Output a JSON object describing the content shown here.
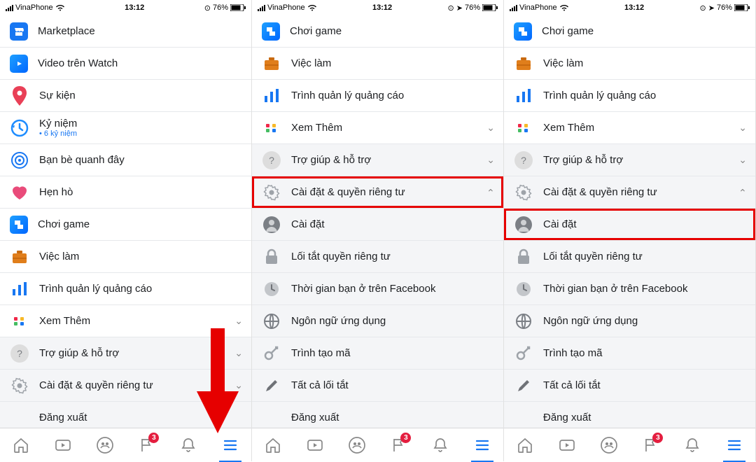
{
  "status": {
    "carrier": "VinaPhone",
    "time": "13:12",
    "battery": "76%"
  },
  "panel1": {
    "items": [
      {
        "icon": "marketplace",
        "label": "Marketplace"
      },
      {
        "icon": "video",
        "label": "Video trên Watch"
      },
      {
        "icon": "event",
        "label": "Sự kiện"
      },
      {
        "icon": "memory",
        "label": "Kỷ niệm",
        "sub": "6 kỷ niệm"
      },
      {
        "icon": "nearby",
        "label": "Bạn bè quanh đây"
      },
      {
        "icon": "dating",
        "label": "Hẹn hò"
      },
      {
        "icon": "game",
        "label": "Chơi game"
      },
      {
        "icon": "jobs",
        "label": "Việc làm"
      },
      {
        "icon": "ads",
        "label": "Trình quản lý quảng cáo"
      },
      {
        "icon": "more",
        "label": "Xem Thêm",
        "chev": "down"
      },
      {
        "icon": "help",
        "label": "Trợ giúp & hỗ trợ",
        "chev": "down",
        "section": true
      },
      {
        "icon": "settings",
        "label": "Cài đặt & quyền riêng tư",
        "chev": "down",
        "section": true
      },
      {
        "icon": "none",
        "label": "Đăng xuất",
        "section": true
      }
    ]
  },
  "panel2": {
    "highlight_index": 5,
    "items": [
      {
        "icon": "game",
        "label": "Chơi game"
      },
      {
        "icon": "jobs",
        "label": "Việc làm"
      },
      {
        "icon": "ads",
        "label": "Trình quản lý quảng cáo"
      },
      {
        "icon": "more",
        "label": "Xem Thêm",
        "chev": "down"
      },
      {
        "icon": "help",
        "label": "Trợ giúp & hỗ trợ",
        "chev": "down",
        "section": true
      },
      {
        "icon": "settings",
        "label": "Cài đặt & quyền riêng tư",
        "chev": "up",
        "section": true
      },
      {
        "icon": "profile",
        "label": "Cài đặt",
        "section": true
      },
      {
        "icon": "lock",
        "label": "Lối tắt quyền riêng tư",
        "section": true
      },
      {
        "icon": "clock",
        "label": "Thời gian bạn ở trên Facebook",
        "section": true
      },
      {
        "icon": "globe",
        "label": "Ngôn ngữ ứng dụng",
        "section": true
      },
      {
        "icon": "key",
        "label": "Trình tạo mã",
        "section": true
      },
      {
        "icon": "pencil",
        "label": "Tất cả lối tắt",
        "section": true
      },
      {
        "icon": "none",
        "label": "Đăng xuất",
        "section": true
      }
    ]
  },
  "panel3": {
    "highlight_index": 6,
    "items": [
      {
        "icon": "game",
        "label": "Chơi game"
      },
      {
        "icon": "jobs",
        "label": "Việc làm"
      },
      {
        "icon": "ads",
        "label": "Trình quản lý quảng cáo"
      },
      {
        "icon": "more",
        "label": "Xem Thêm",
        "chev": "down"
      },
      {
        "icon": "help",
        "label": "Trợ giúp & hỗ trợ",
        "chev": "down",
        "section": true
      },
      {
        "icon": "settings",
        "label": "Cài đặt & quyền riêng tư",
        "chev": "up",
        "section": true
      },
      {
        "icon": "profile",
        "label": "Cài đặt",
        "section": true
      },
      {
        "icon": "lock",
        "label": "Lối tắt quyền riêng tư",
        "section": true
      },
      {
        "icon": "clock",
        "label": "Thời gian bạn ở trên Facebook",
        "section": true
      },
      {
        "icon": "globe",
        "label": "Ngôn ngữ ứng dụng",
        "section": true
      },
      {
        "icon": "key",
        "label": "Trình tạo mã",
        "section": true
      },
      {
        "icon": "pencil",
        "label": "Tất cả lối tắt",
        "section": true
      },
      {
        "icon": "none",
        "label": "Đăng xuất",
        "section": true
      }
    ]
  },
  "tabs": {
    "badge": "3"
  }
}
